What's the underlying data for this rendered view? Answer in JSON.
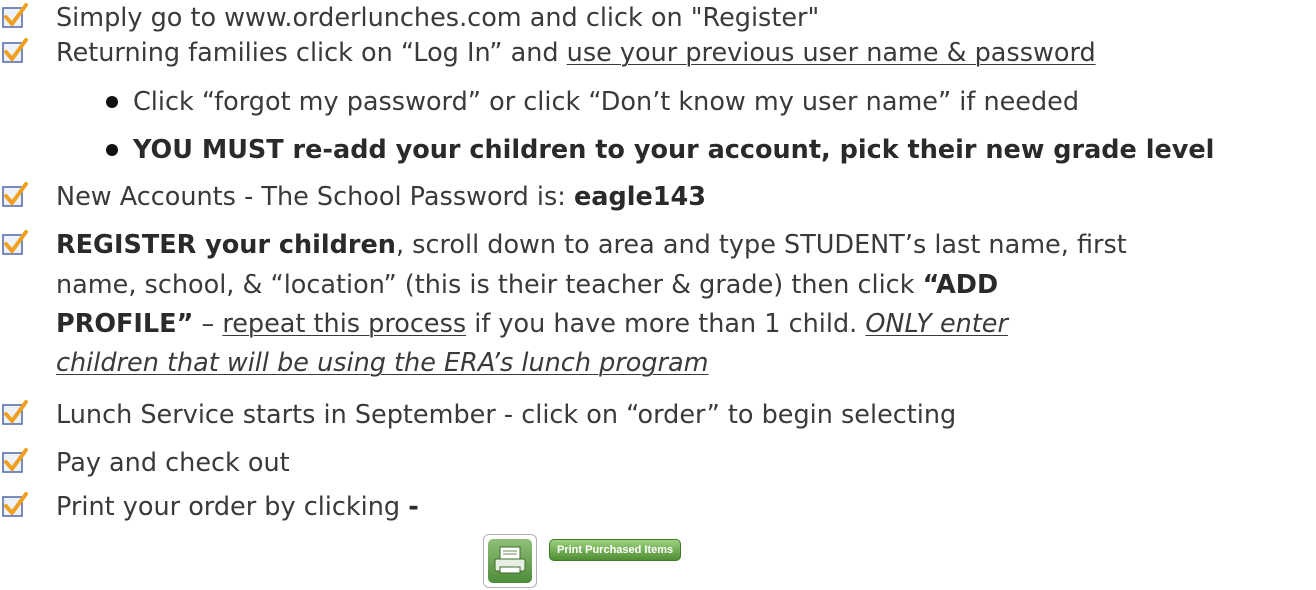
{
  "colors": {
    "checkbox_border": "#5a6fb0",
    "checkmark": "#f0a020",
    "button_green": "#5a9a3e"
  },
  "items": [
    {
      "text": "Simply go to www.orderlunches.com and click on \"Register\""
    },
    {
      "text_a": "Returning families click on “Log In” and ",
      "link": "use your previous user name & password"
    },
    {
      "sub1": "Click “forgot my password”  or click “Don’t know my user name” if needed"
    },
    {
      "sub2": "YOU MUST re-add your children to your account, pick their new grade level"
    },
    {
      "text_a": "New Accounts -  The School Password is:  ",
      "bold": "eagle143"
    },
    {
      "bold_a": "REGISTER your children",
      "line1_rest": ", scroll down to area and type STUDENT’s last name, first",
      "line2_a": "name, school, & “location” (this is their teacher & grade) then click ",
      "line2_bold": "“ADD",
      "line3_bold": "PROFILE”",
      "line3_b": " – ",
      "line3_u": "repeat this process",
      "line3_c": " if you have more than 1 child.  ",
      "line3_iu": "ONLY enter",
      "line4_iu": "children that will be using the ERA’s lunch program"
    },
    {
      "text": "Lunch Service starts in September  - click on “order” to begin selecting"
    },
    {
      "text": "Pay and check out"
    },
    {
      "text_a": "Print your order by clicking ",
      "bold": "-",
      "button_label": "Print Purchased Items"
    }
  ]
}
